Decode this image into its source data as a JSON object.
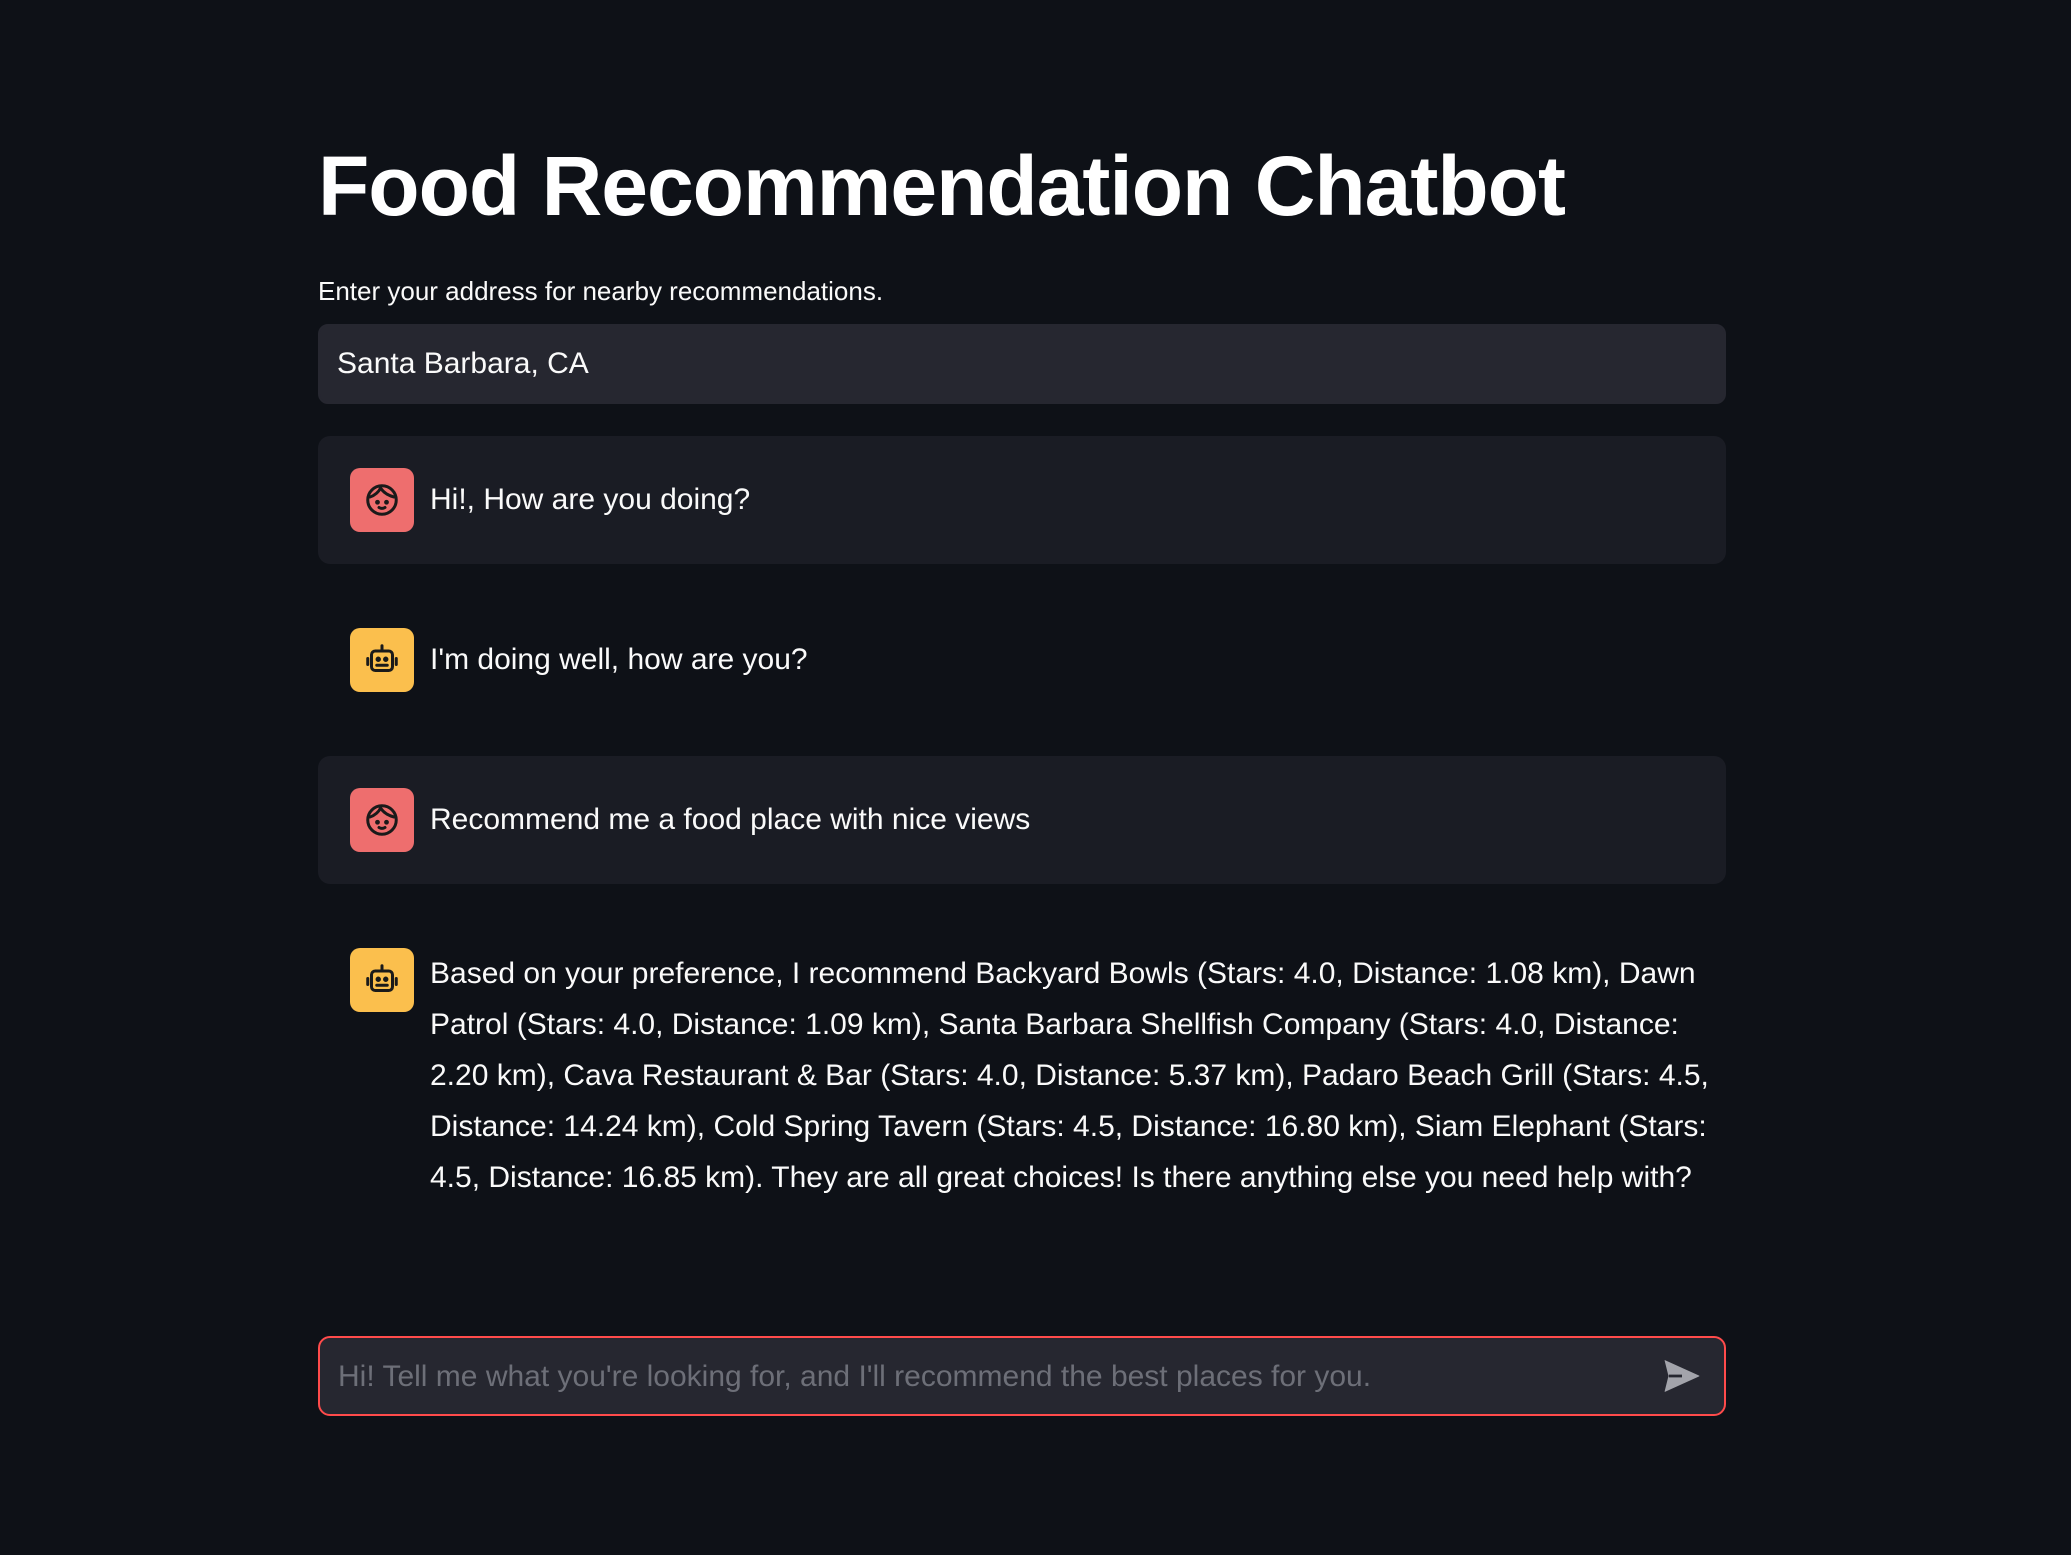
{
  "page": {
    "title": "Food Recommendation Chatbot"
  },
  "address": {
    "label": "Enter your address for nearby recommendations.",
    "value": "Santa Barbara, CA"
  },
  "messages": [
    {
      "role": "user",
      "avatar_icon": "user-face-icon",
      "text": "Hi!, How are you doing?"
    },
    {
      "role": "assistant",
      "avatar_icon": "robot-icon",
      "text": "I'm doing well, how are you?"
    },
    {
      "role": "user",
      "avatar_icon": "user-face-icon",
      "text": "Recommend me a food place with nice views"
    },
    {
      "role": "assistant",
      "avatar_icon": "robot-icon",
      "text": "Based on your preference, I recommend Backyard Bowls (Stars: 4.0, Distance: 1.08 km), Dawn Patrol (Stars: 4.0, Distance: 1.09 km), Santa Barbara Shellfish Company (Stars: 4.0, Distance: 2.20 km), Cava Restaurant & Bar (Stars: 4.0, Distance: 5.37 km), Padaro Beach Grill (Stars: 4.5, Distance: 14.24 km), Cold Spring Tavern (Stars: 4.5, Distance: 16.80 km), Siam Elephant (Stars: 4.5, Distance: 16.85 km). They are all great choices! Is there anything else you need help with?"
    }
  ],
  "chat_input": {
    "placeholder": "Hi! Tell me what you're looking for, and I'll recommend the best places for you.",
    "send_icon": "send-icon"
  },
  "colors": {
    "background": "#0e1117",
    "user_message_bg": "#1a1c24",
    "user_avatar": "#ee6e6e",
    "bot_avatar": "#fbbf4d",
    "input_bg": "#262730",
    "accent": "#ff4b4b"
  }
}
